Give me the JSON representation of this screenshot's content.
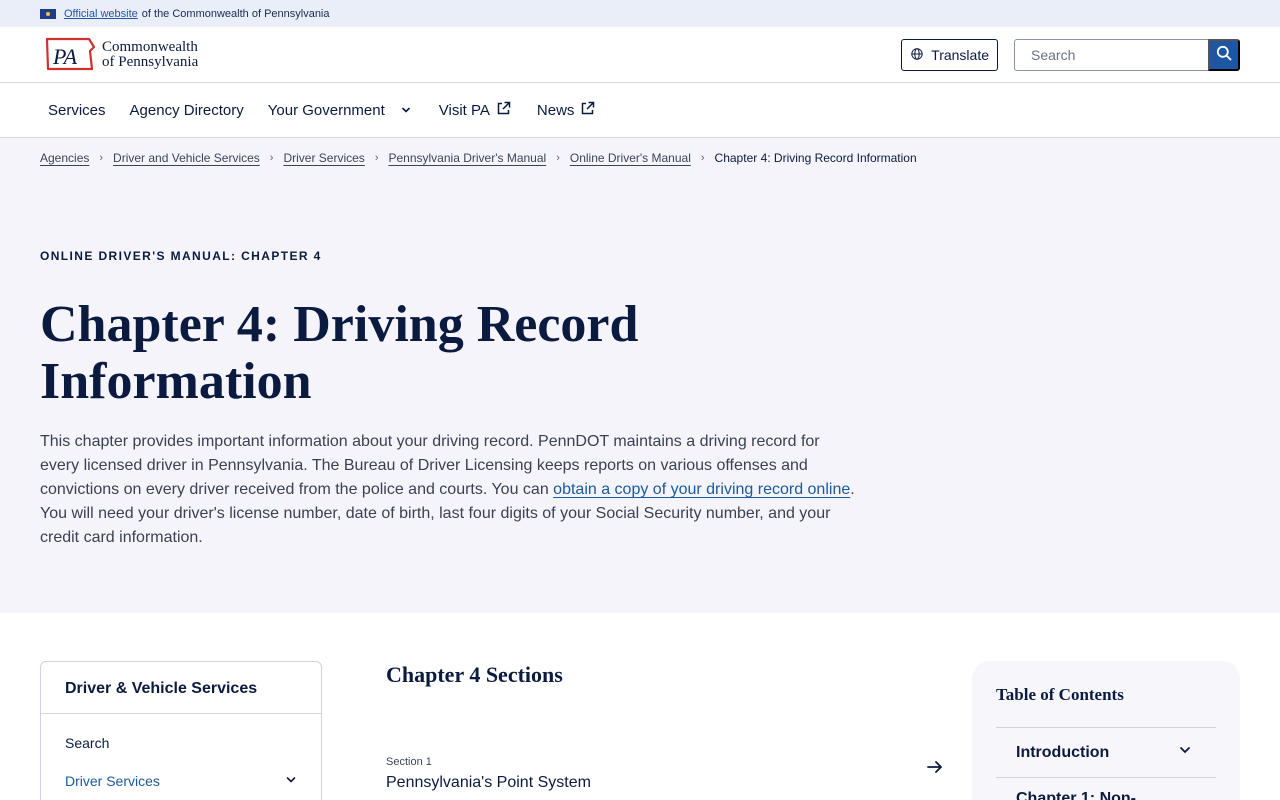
{
  "gov_banner": {
    "link_text": "Official website",
    "suffix_text": "of the Commonwealth of Pennsylvania"
  },
  "header": {
    "logo_monogram": "PA",
    "logo_line1": "Commonwealth",
    "logo_line2": "of Pennsylvania",
    "translate_label": "Translate",
    "search_placeholder": "Search"
  },
  "nav": {
    "items": [
      {
        "label": "Services"
      },
      {
        "label": "Agency Directory"
      },
      {
        "label": "Your Government"
      },
      {
        "label": "Visit PA"
      },
      {
        "label": "News"
      }
    ]
  },
  "breadcrumb": [
    "Agencies",
    "Driver and Vehicle Services",
    "Driver Services",
    "Pennsylvania Driver's Manual",
    "Online Driver's Manual",
    "Chapter 4: Driving Record Information"
  ],
  "hero": {
    "eyebrow": "ONLINE DRIVER'S MANUAL: CHAPTER 4",
    "title": "Chapter 4: Driving Record Information",
    "intro_before": "This chapter provides important information about your driving record. PennDOT maintains a driving record for every licensed driver in Pennsylvania. The Bureau of Driver Licensing keeps reports on various offenses and convictions on every driver received from the police and courts. You can ",
    "intro_link": "obtain a copy of your driving record online",
    "intro_after": ". You will need your driver's license number, date of birth, last four digits of your Social Security number, and your credit card information."
  },
  "side_menu": {
    "title": "Driver & Vehicle Services",
    "items": [
      {
        "label": "Search"
      },
      {
        "label": "Driver Services"
      }
    ]
  },
  "sections": {
    "title": "Chapter 4 Sections",
    "items": [
      {
        "label": "Section 1",
        "name": "Pennsylvania's Point System"
      }
    ]
  },
  "toc": {
    "title": "Table of Contents",
    "items": [
      {
        "label": "Introduction"
      },
      {
        "label": "Chapter 1: Non-"
      }
    ]
  },
  "colors": {
    "navy": "#0b1b3f",
    "link_blue": "#1a5a9e",
    "search_button": "#1f56a3",
    "hero_bg": "#f4f4fa",
    "banner_bg": "#e9eef8"
  }
}
